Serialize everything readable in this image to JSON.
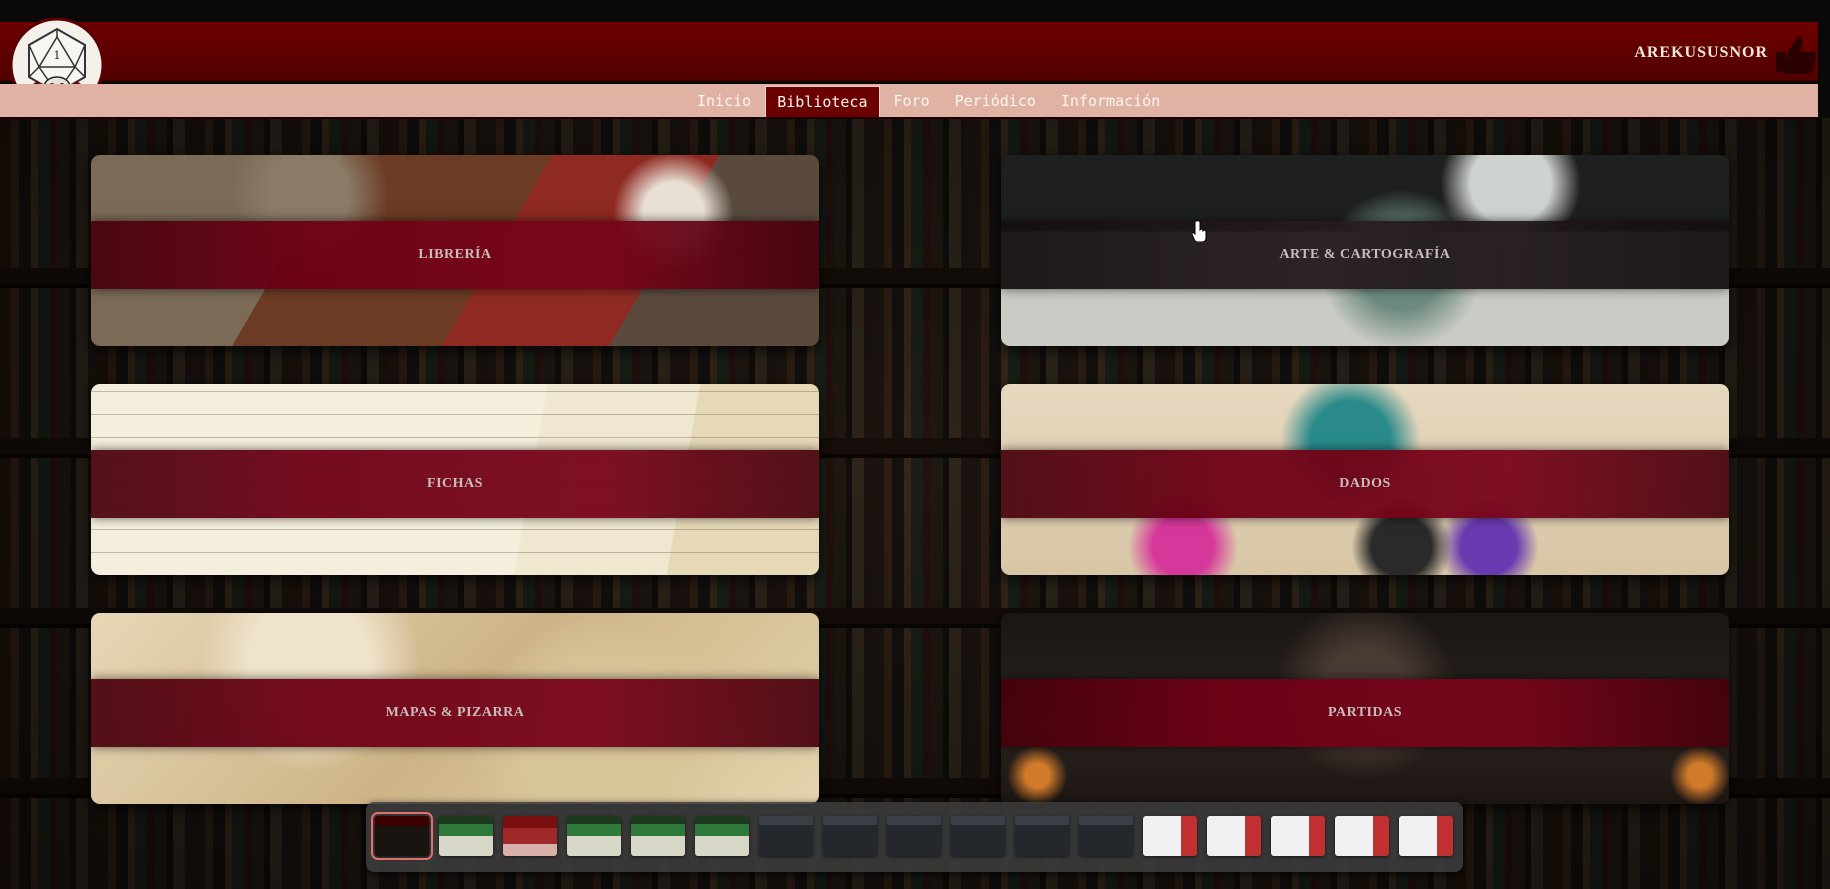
{
  "header": {
    "username": "AREKUSUSNOR",
    "logo_icon": "d20-skull-logo-icon",
    "logo_number": "1",
    "user_icon": "thumbs-up-icon"
  },
  "nav": {
    "items": [
      {
        "label": "Inicio",
        "active": false
      },
      {
        "label": "Biblioteca",
        "active": true
      },
      {
        "label": "Foro",
        "active": false
      },
      {
        "label": "Periódico",
        "active": false
      },
      {
        "label": "Información",
        "active": false
      }
    ]
  },
  "library": {
    "cards": [
      {
        "label": "LIBRERÍA"
      },
      {
        "label": "ARTE & CARTOGRAFÍA"
      },
      {
        "label": "FICHAS"
      },
      {
        "label": "DADOS"
      },
      {
        "label": "MAPAS & PIZARRA"
      },
      {
        "label": "PARTIDAS"
      }
    ]
  },
  "colors": {
    "header_red": "#6e0000",
    "nav_bar": "#e0b2a4",
    "band_red": "#780519"
  },
  "thumbnails": {
    "count": 17,
    "selected_index": 0
  }
}
